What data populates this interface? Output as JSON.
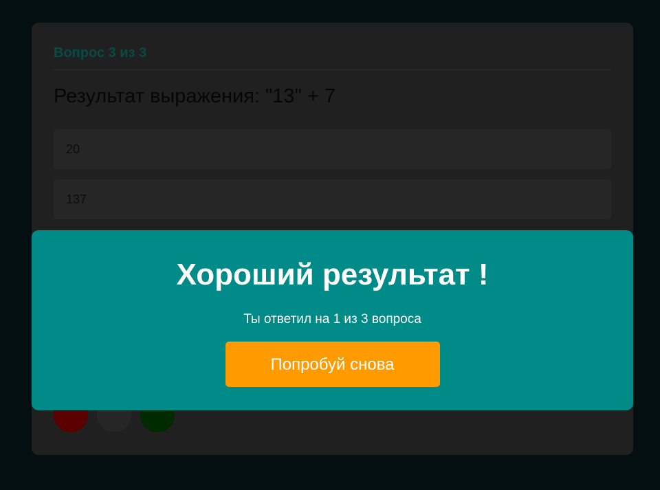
{
  "quiz": {
    "counter": "Вопрос 3 из 3",
    "question": "Результат выражения: \"13\" + 7",
    "answers": [
      "20",
      "137"
    ],
    "progress_dots": [
      {
        "status": "wrong",
        "color": "#5a0000"
      },
      {
        "status": "unanswered",
        "color": "#262626"
      },
      {
        "status": "correct",
        "color": "#002a00"
      }
    ]
  },
  "result": {
    "title": "Хороший результат !",
    "summary": "Ты ответил на 1 из 3 вопроса",
    "retry_label": "Попробуй снова"
  },
  "colors": {
    "overlay": "#008b88",
    "accent": "#ff9a00"
  }
}
